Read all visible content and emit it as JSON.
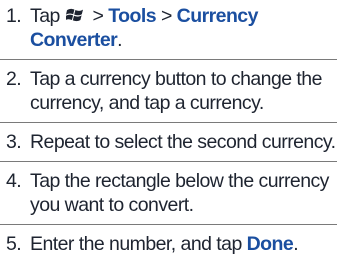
{
  "colors": {
    "text": "#1e2430",
    "bold_accent": "#1b4fa0",
    "divider": "#7a7a7a"
  },
  "steps": [
    {
      "number": "1.",
      "prefix": "Tap",
      "icon": "windows-start-icon",
      "sep": ">",
      "tools": "Tools",
      "sep2": ">",
      "converter": "Currency Converter",
      "suffix": "."
    },
    {
      "number": "2.",
      "text": "Tap a currency button to change the currency, and tap a currency."
    },
    {
      "number": "3.",
      "text": "Repeat to select the second currency."
    },
    {
      "number": "4.",
      "text": "Tap the rectangle below the currency you want to convert."
    },
    {
      "number": "5.",
      "prefix": "Enter the number, and tap",
      "done": "Done",
      "suffix": "."
    }
  ]
}
